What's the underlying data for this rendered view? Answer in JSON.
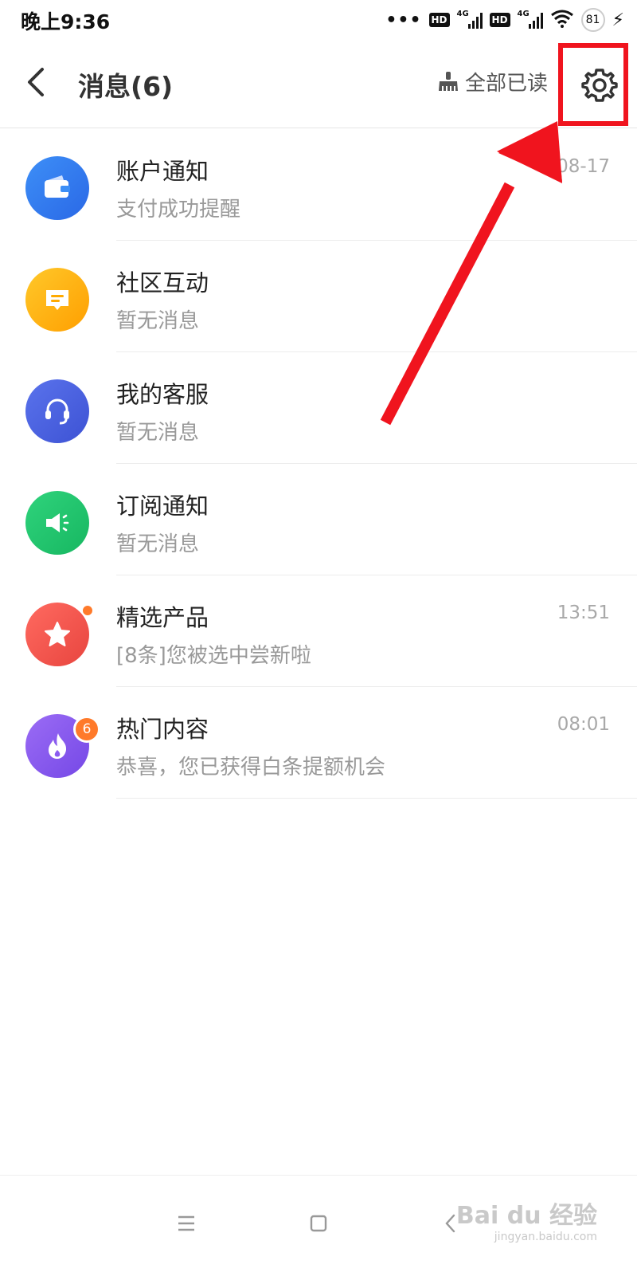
{
  "status_bar": {
    "time": "晚上9:36",
    "network_a": "4G",
    "network_b": "4G",
    "hd_a": "HD",
    "hd_b": "HD",
    "battery": "81",
    "icons": [
      "more-dots-icon",
      "hd-icon",
      "signal-icon",
      "wifi-icon",
      "battery-icon",
      "charging-icon"
    ]
  },
  "header": {
    "title": "消息(6)",
    "read_all_label": "全部已读",
    "back_icon": "chevron-left-icon",
    "settings_icon": "gear-icon",
    "highlight_color": "#f0141e"
  },
  "messages": [
    {
      "name": "账户通知",
      "sub": "支付成功提醒",
      "time": "08-17",
      "icon": "wallet-icon",
      "color": "#2f7bf0"
    },
    {
      "name": "社区互动",
      "sub": "暂无消息",
      "time": "",
      "icon": "chat-bubble-icon",
      "color": "#ffb300"
    },
    {
      "name": "我的客服",
      "sub": "暂无消息",
      "time": "",
      "icon": "headset-icon",
      "color": "#4a63e0"
    },
    {
      "name": "订阅通知",
      "sub": "暂无消息",
      "time": "",
      "icon": "speaker-icon",
      "color": "#1fc46e"
    },
    {
      "name": "精选产品",
      "sub": "[8条]您被选中尝新啦",
      "time": "13:51",
      "icon": "star-icon",
      "color": "#f2544d",
      "unread_dot": true
    },
    {
      "name": "热门内容",
      "sub": "恭喜，您已获得白条提额机会",
      "time": "08:01",
      "icon": "flame-icon",
      "color": "#8b5cf0",
      "badge": "6"
    }
  ],
  "nav_bar": {
    "icons": [
      "menu-icon",
      "home-square-icon",
      "back-triangle-icon"
    ]
  },
  "watermark": {
    "line1": "Bai du 经验",
    "line2": "jingyan.baidu.com"
  }
}
